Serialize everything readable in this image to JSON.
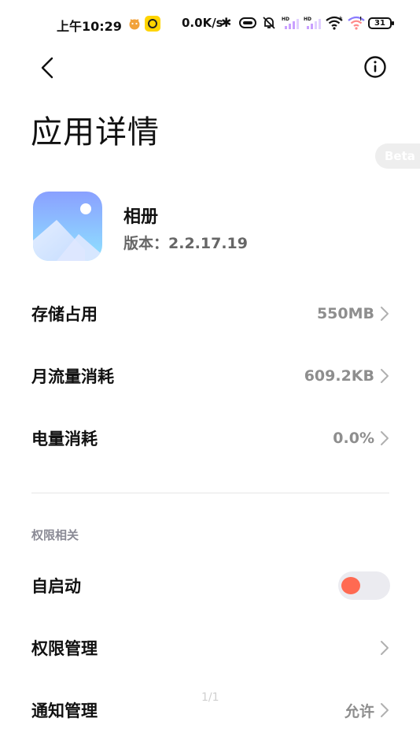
{
  "status_bar": {
    "time": "上午10:29",
    "speed": "0.0K/s",
    "battery": "31",
    "icons": [
      "bluetooth-icon",
      "nfc-icon",
      "mute-icon",
      "signal-hd-icon",
      "signal-hd-icon",
      "wifi-icon",
      "wifi-plus-icon",
      "battery-icon"
    ]
  },
  "header": {
    "title": "应用详情",
    "beta": "Beta"
  },
  "app": {
    "name": "相册",
    "version_label": "版本：",
    "version": "2.2.17.19"
  },
  "rows": {
    "storage": {
      "label": "存储占用",
      "value": "550MB"
    },
    "traffic": {
      "label": "月流量消耗",
      "value": "609.2KB"
    },
    "battery": {
      "label": "电量消耗",
      "value": "0.0%"
    }
  },
  "permissions": {
    "section_label": "权限相关",
    "autostart": {
      "label": "自启动",
      "enabled": false
    },
    "permission_manage": {
      "label": "权限管理"
    },
    "notification": {
      "label": "通知管理",
      "value": "允许"
    }
  },
  "page_indicator": "1/1",
  "colors": {
    "accent_toggle": "#ff6a52",
    "value_text": "#8e8e8e",
    "icon_gradient_top": "#8aa0ff",
    "icon_gradient_bottom": "#8fe3ff"
  }
}
